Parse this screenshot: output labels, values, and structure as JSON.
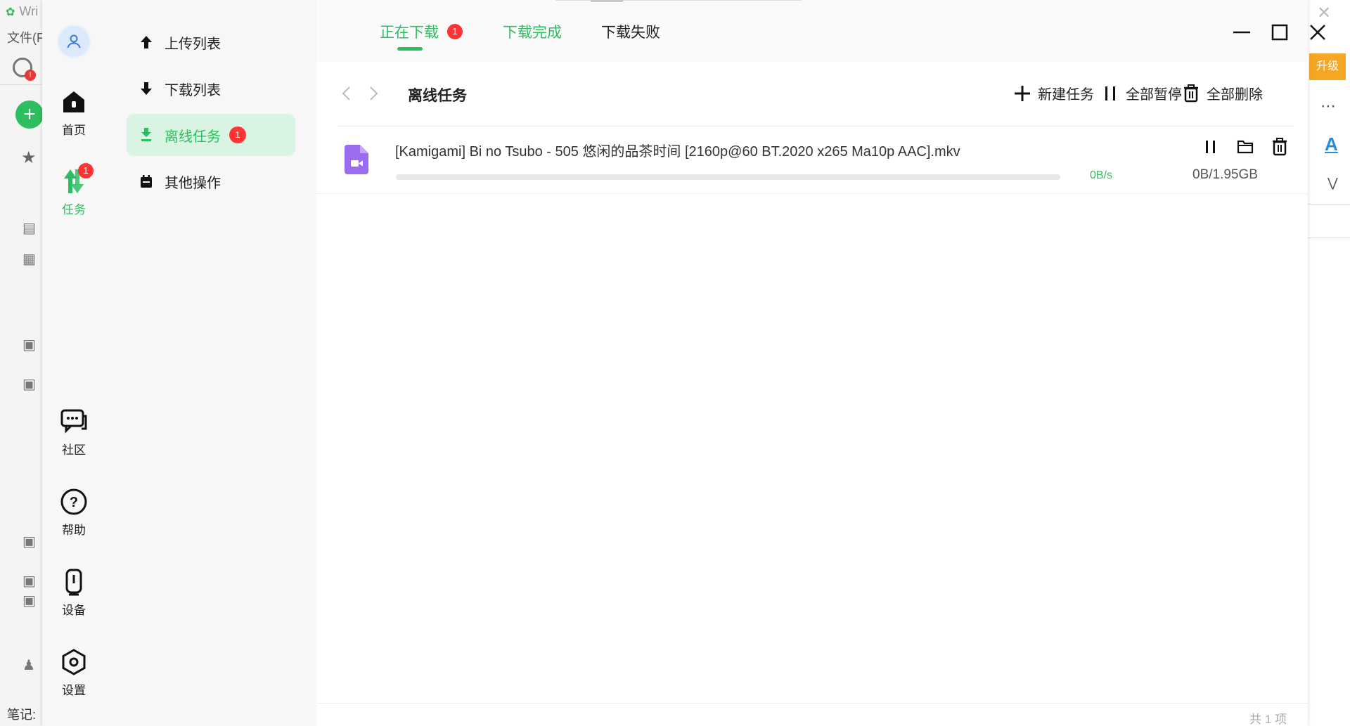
{
  "background_app": {
    "title": "Wri",
    "menu_file": "文件(F",
    "sync_badge": "!",
    "upgrade_label": "升级",
    "status_label": "笔记:"
  },
  "rail": {
    "items": [
      {
        "label": "首页",
        "icon": "home-icon"
      },
      {
        "label": "任务",
        "icon": "transfer-icon",
        "badge": "1",
        "active": true
      },
      {
        "label": "社区",
        "icon": "chat-icon"
      },
      {
        "label": "帮助",
        "icon": "help-icon"
      },
      {
        "label": "设备",
        "icon": "device-icon"
      },
      {
        "label": "设置",
        "icon": "settings-icon"
      }
    ]
  },
  "nav": {
    "items": [
      {
        "label": "上传列表",
        "icon": "upload-arrow-icon"
      },
      {
        "label": "下载列表",
        "icon": "download-arrow-icon"
      },
      {
        "label": "离线任务",
        "icon": "offline-download-icon",
        "badge": "1",
        "active": true
      },
      {
        "label": "其他操作",
        "icon": "calendar-icon"
      }
    ]
  },
  "tabs": [
    {
      "label": "正在下载",
      "badge": "1",
      "active": true
    },
    {
      "label": "下载完成"
    },
    {
      "label": "下载失败"
    }
  ],
  "toolbar": {
    "breadcrumb": "离线任务",
    "new_task": "新建任务",
    "pause_all": "全部暂停",
    "delete_all": "全部删除"
  },
  "tasks": [
    {
      "name": "[Kamigami] Bi no Tsubo - 505 悠闲的品茶时间 [2160p@60 BT.2020 x265 Ma10p AAC].mkv",
      "speed": "0B/s",
      "size": "0B/1.95GB",
      "progress": 0
    }
  ],
  "footer": {
    "count": "共 1 项"
  },
  "colors": {
    "accent": "#2dbe60",
    "badge": "#ff3333",
    "active_bg": "#d9f4e2",
    "file_icon": "#9b6cf0"
  }
}
